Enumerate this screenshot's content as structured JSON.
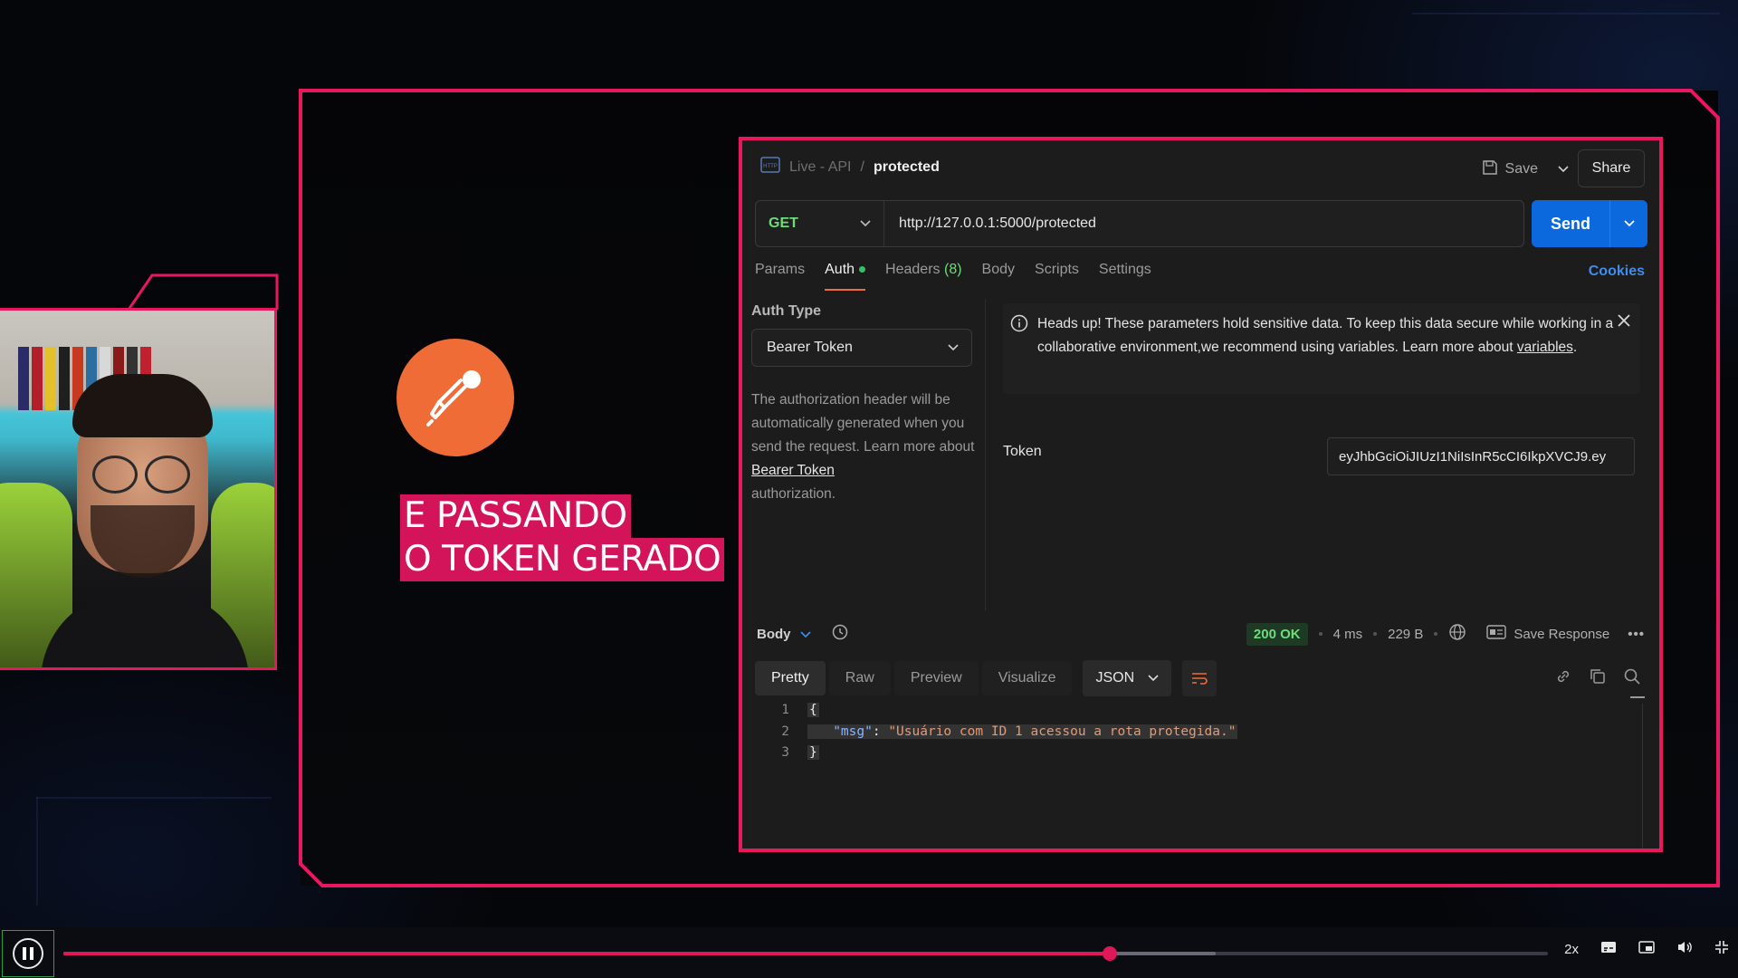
{
  "request": {
    "crumb": "Live - API",
    "separator": "/",
    "name": "protected",
    "save_label": "Save",
    "share_label": "Share",
    "method": "GET",
    "url": "http://127.0.0.1:5000/protected",
    "send_label": "Send",
    "tabs": [
      {
        "label": "Params"
      },
      {
        "label": "Auth"
      },
      {
        "label": "Headers",
        "count": "(8)"
      },
      {
        "label": "Body"
      },
      {
        "label": "Scripts"
      },
      {
        "label": "Settings"
      }
    ],
    "cookies_label": "Cookies"
  },
  "auth": {
    "type_label": "Auth Type",
    "type_value": "Bearer Token",
    "help_text_1": "The authorization header will be automatically generated when you send the request. Learn more about ",
    "help_link": "Bearer Token",
    "help_text_2": "authorization.",
    "notice_text_1": "Heads up! These parameters hold sensitive data. To keep this data secure while working in a collaborative environment,we recommend using variables. Learn more about ",
    "notice_link": "variables",
    "notice_end": ".",
    "token_label": "Token",
    "token_value": "eyJhbGciOiJIUzI1NiIsInR5cCI6IkpXVCJ9.ey"
  },
  "response": {
    "body_label": "Body",
    "status": "200 OK",
    "time": "4 ms",
    "size": "229 B",
    "save_response_label": "Save Response",
    "tabs": [
      "Pretty",
      "Raw",
      "Preview",
      "Visualize"
    ],
    "format": "JSON",
    "lines": [
      {
        "n": "1",
        "text": "{"
      },
      {
        "n": "2",
        "key": "\"msg\"",
        "colon": ": ",
        "value": "\"Usuário com ID 1 acessou a rota protegida.\""
      },
      {
        "n": "3",
        "text": "}"
      }
    ]
  },
  "overlay": {
    "caption_line1": "E PASSANDO",
    "caption_line2": "O TOKEN GERADO"
  },
  "player": {
    "speed": "2x",
    "progress": 0.705,
    "buffered": 0.776
  },
  "colors": {
    "accent": "#e8185f",
    "postman_orange": "#ef6c37",
    "send_blue": "#0b69dd",
    "status_green": "#6bdd7a"
  }
}
